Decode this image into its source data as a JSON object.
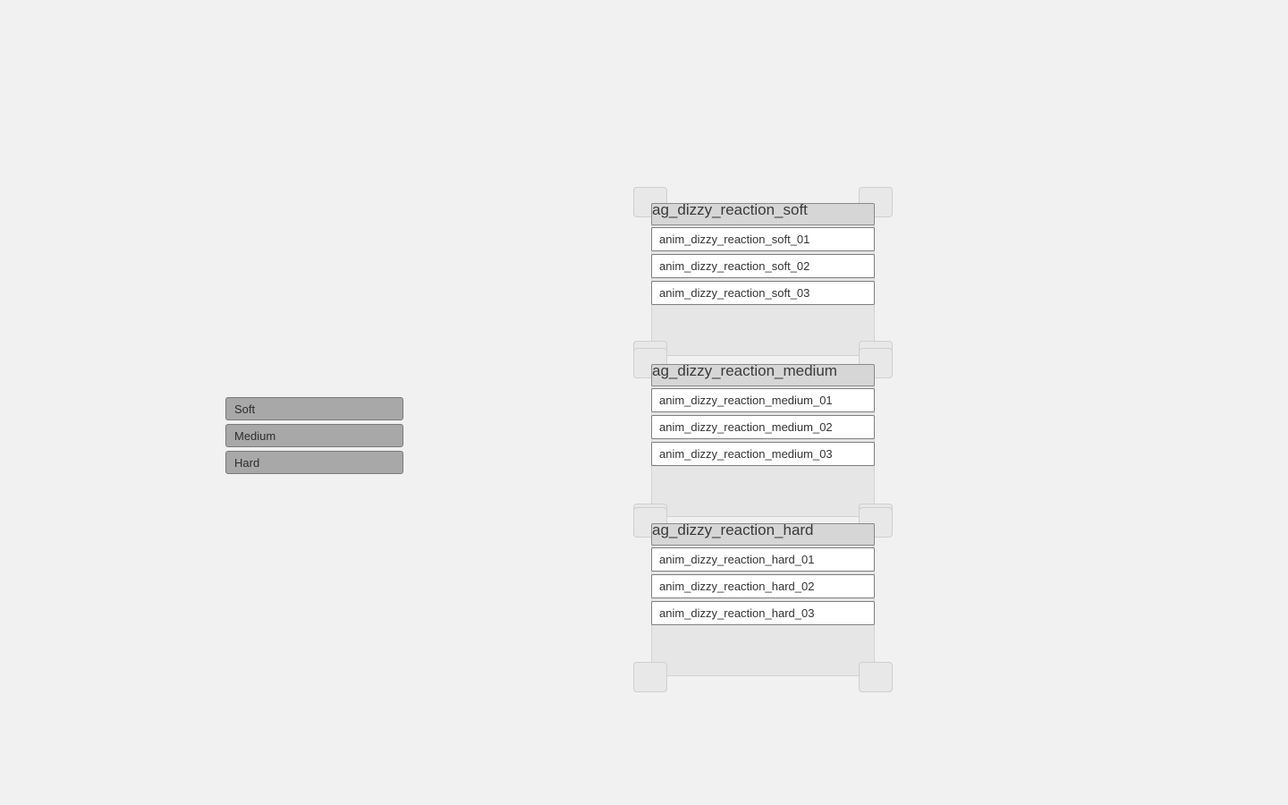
{
  "selector": {
    "items": [
      {
        "label": "Soft"
      },
      {
        "label": "Medium"
      },
      {
        "label": "Hard"
      }
    ]
  },
  "groups": [
    {
      "title": "ag_dizzy_reaction_soft",
      "anims": [
        "anim_dizzy_reaction_soft_01",
        "anim_dizzy_reaction_soft_02",
        "anim_dizzy_reaction_soft_03"
      ]
    },
    {
      "title": "ag_dizzy_reaction_medium",
      "anims": [
        "anim_dizzy_reaction_medium_01",
        "anim_dizzy_reaction_medium_02",
        "anim_dizzy_reaction_medium_03"
      ]
    },
    {
      "title": "ag_dizzy_reaction_hard",
      "anims": [
        "anim_dizzy_reaction_hard_01",
        "anim_dizzy_reaction_hard_02",
        "anim_dizzy_reaction_hard_03"
      ]
    }
  ],
  "colors": {
    "background": "#f1f1f1",
    "selector_item": "#a8a8a8",
    "group_body": "#e6e6e6",
    "group_title": "#d6d6d6",
    "anim_item": "#ffffff"
  }
}
